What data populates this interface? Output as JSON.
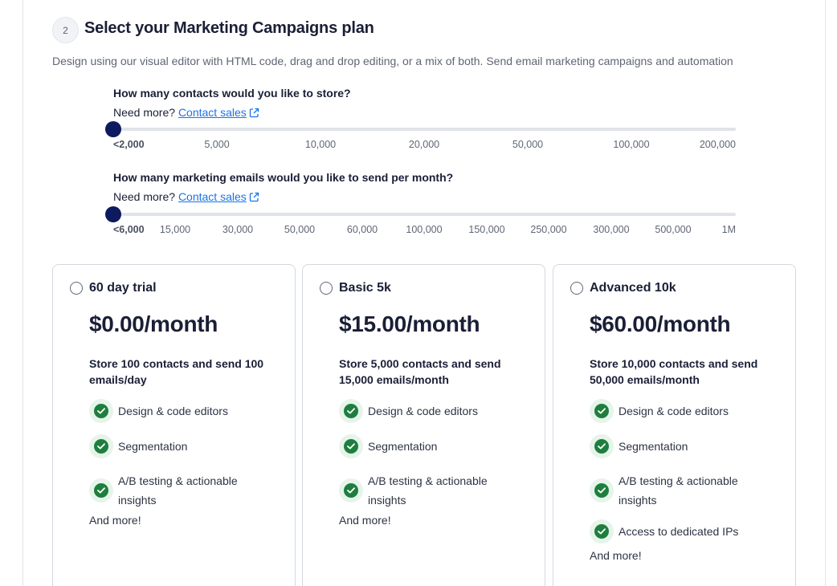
{
  "step": {
    "number": "2",
    "title": "Select your Marketing Campaigns plan",
    "description": "Design using our visual editor with HTML code, drag and drop editing, or a mix of both. Send email marketing campaigns and automation"
  },
  "contacts_question": {
    "title": "How many contacts would you like to store?",
    "need_more": "Need more?",
    "link": "Contact sales",
    "selected_index": 0,
    "ticks": [
      "<2,000",
      "5,000",
      "10,000",
      "20,000",
      "50,000",
      "100,000",
      "200,000"
    ]
  },
  "emails_question": {
    "title": "How many marketing emails would you like to send per month?",
    "need_more": "Need more?",
    "link": "Contact sales",
    "selected_index": 0,
    "ticks": [
      "<6,000",
      "15,000",
      "30,000",
      "50,000",
      "60,000",
      "100,000",
      "150,000",
      "250,000",
      "300,000",
      "500,000",
      "1M"
    ]
  },
  "plans": [
    {
      "name": "60 day trial",
      "price": "$0.00/month",
      "summary": "Store 100 contacts and send 100 emails/day",
      "features": [
        "Design & code editors",
        "Segmentation",
        "A/B testing & actionable insights"
      ],
      "more": "And more!"
    },
    {
      "name": "Basic 5k",
      "price": "$15.00/month",
      "summary": "Store 5,000 contacts and send 15,000 emails/month",
      "features": [
        "Design & code editors",
        "Segmentation",
        "A/B testing & actionable insights"
      ],
      "more": "And more!"
    },
    {
      "name": "Advanced 10k",
      "price": "$60.00/month",
      "summary": "Store 10,000 contacts and send 50,000 emails/month",
      "features": [
        "Design & code editors",
        "Segmentation",
        "A/B testing & actionable insights",
        "Access to dedicated IPs"
      ],
      "more": "And more!"
    }
  ],
  "colors": {
    "accent": "#0d1a5f",
    "link": "#1a73e8",
    "check": "#1e7e3e"
  },
  "icons": {
    "external_link": "external-link-icon",
    "feature_check": "check-circle-icon"
  }
}
